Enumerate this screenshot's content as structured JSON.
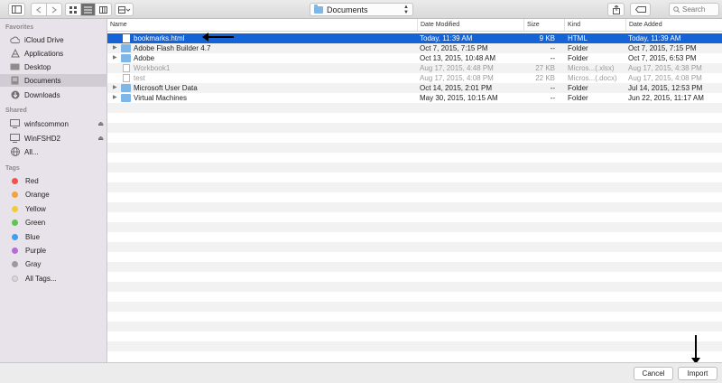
{
  "toolbar": {
    "sidebar_toggle_icon": "sidebar-icon",
    "back_icon": "chevron-left",
    "forward_icon": "chevron-right",
    "location": "Documents",
    "search_placeholder": "Search"
  },
  "sidebar": {
    "favorites_title": "Favorites",
    "favorites": [
      {
        "label": "iCloud Drive",
        "icon": "cloud-icon"
      },
      {
        "label": "Applications",
        "icon": "applications-icon"
      },
      {
        "label": "Desktop",
        "icon": "desktop-icon"
      },
      {
        "label": "Documents",
        "icon": "documents-icon",
        "selected": true
      },
      {
        "label": "Downloads",
        "icon": "downloads-icon"
      }
    ],
    "shared_title": "Shared",
    "shared": [
      {
        "label": "winfscommon",
        "icon": "network-computer-icon"
      },
      {
        "label": "WinFSHD2",
        "icon": "network-computer-icon"
      },
      {
        "label": "All...",
        "icon": "globe-icon"
      }
    ],
    "tags_title": "Tags",
    "tags": [
      {
        "label": "Red",
        "color": "#f1524c"
      },
      {
        "label": "Orange",
        "color": "#f6a13a"
      },
      {
        "label": "Yellow",
        "color": "#f3cc33"
      },
      {
        "label": "Green",
        "color": "#5cc64f"
      },
      {
        "label": "Blue",
        "color": "#3d9fef"
      },
      {
        "label": "Purple",
        "color": "#b86bd7"
      },
      {
        "label": "Gray",
        "color": "#9b9b9b"
      },
      {
        "label": "All Tags...",
        "color": "#d8d8d8"
      }
    ]
  },
  "columns": {
    "name": "Name",
    "modified": "Date Modified",
    "size": "Size",
    "kind": "Kind",
    "added": "Date Added"
  },
  "files": [
    {
      "name": "bookmarks.html",
      "modified": "Today, 11:39 AM",
      "size": "9 KB",
      "kind": "HTML",
      "added": "Today, 11:39 AM",
      "type": "doc",
      "selected": true
    },
    {
      "name": "Adobe Flash Builder 4.7",
      "modified": "Oct 7, 2015, 7:15 PM",
      "size": "--",
      "kind": "Folder",
      "added": "Oct 7, 2015, 7:15 PM",
      "type": "folder"
    },
    {
      "name": "Adobe",
      "modified": "Oct 13, 2015, 10:48 AM",
      "size": "--",
      "kind": "Folder",
      "added": "Oct 7, 2015, 6:53 PM",
      "type": "folder"
    },
    {
      "name": "Workbook1",
      "modified": "Aug 17, 2015, 4:48 PM",
      "size": "27 KB",
      "kind": "Micros...(.xlsx)",
      "added": "Aug 17, 2015, 4:38 PM",
      "type": "doc",
      "dim": true
    },
    {
      "name": "test",
      "modified": "Aug 17, 2015, 4:08 PM",
      "size": "22 KB",
      "kind": "Micros...(.docx)",
      "added": "Aug 17, 2015, 4:08 PM",
      "type": "doc",
      "dim": true
    },
    {
      "name": "Microsoft User Data",
      "modified": "Oct 14, 2015, 2:01 PM",
      "size": "--",
      "kind": "Folder",
      "added": "Jul 14, 2015, 12:53 PM",
      "type": "folder"
    },
    {
      "name": "Virtual Machines",
      "modified": "May 30, 2015, 10:15 AM",
      "size": "--",
      "kind": "Folder",
      "added": "Jun 22, 2015, 11:17 AM",
      "type": "folder"
    }
  ],
  "buttons": {
    "cancel": "Cancel",
    "import": "Import"
  }
}
